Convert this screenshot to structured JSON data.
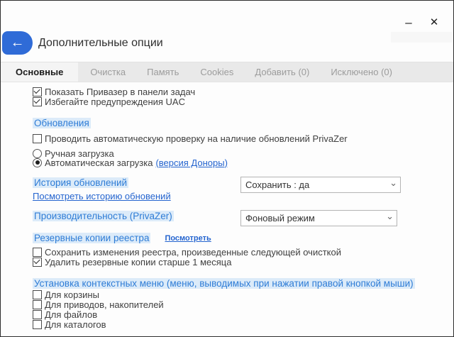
{
  "colors": {
    "accent_blue": "#2f6bd7",
    "heading_blue": "#2e7cd6",
    "heading_highlight": "#dcebf9",
    "link_blue": "#2464cf",
    "tab_strip_bg": "#e9e9e9"
  },
  "icons": {
    "back": "←",
    "minimize": "–",
    "close": "✕",
    "chevron_down": "⌄"
  },
  "window": {
    "title": "Дополнительные опции"
  },
  "tabs": {
    "items": [
      {
        "label": "Основные",
        "active": true
      },
      {
        "label": "Очистка",
        "active": false
      },
      {
        "label": "Память",
        "active": false
      },
      {
        "label": "Cookies",
        "active": false
      },
      {
        "label": "Добавить (0)",
        "active": false
      },
      {
        "label": "Исключено (0)",
        "active": false
      }
    ]
  },
  "main": {
    "top_checkboxes": [
      {
        "label": "Показать Привазер в панели задач",
        "checked": true
      },
      {
        "label": "Избегайте предупреждения UAC",
        "checked": true
      }
    ],
    "updates": {
      "heading": "Обновления",
      "auto_check": {
        "label": "Проводить автоматическую проверку на наличие обновлений PrivaZer",
        "checked": false
      },
      "manual_radio": {
        "label": "Ручная загрузка",
        "selected": false
      },
      "auto_radio": {
        "label": "Автоматическая загрузка",
        "selected": true,
        "link": "(версия Доноры)"
      }
    },
    "history": {
      "label": "История обновлений",
      "dropdown_value": "Сохранить : да",
      "link": "Посмотреть историю обновений"
    },
    "performance": {
      "label": "Производительность (PrivaZer)",
      "dropdown_value": "Фоновый режим"
    },
    "registry": {
      "heading": "Резервные копии реестра",
      "link": "Посмотреть",
      "checkboxes": [
        {
          "label": "Сохранить изменения реестра, произведенные следующей очисткой",
          "checked": false
        },
        {
          "label": "Удалить резервные копии старше 1 месяца",
          "checked": true
        }
      ]
    },
    "context_menus": {
      "heading": "Установка контекстных меню (меню, выводимых при нажатии правой кнопкой мыши)",
      "checkboxes": [
        {
          "label": "Для корзины",
          "checked": false
        },
        {
          "label": "Для приводов, накопителей",
          "checked": false
        },
        {
          "label": "Для файлов",
          "checked": false
        },
        {
          "label": "Для каталогов",
          "checked": false
        }
      ]
    }
  }
}
